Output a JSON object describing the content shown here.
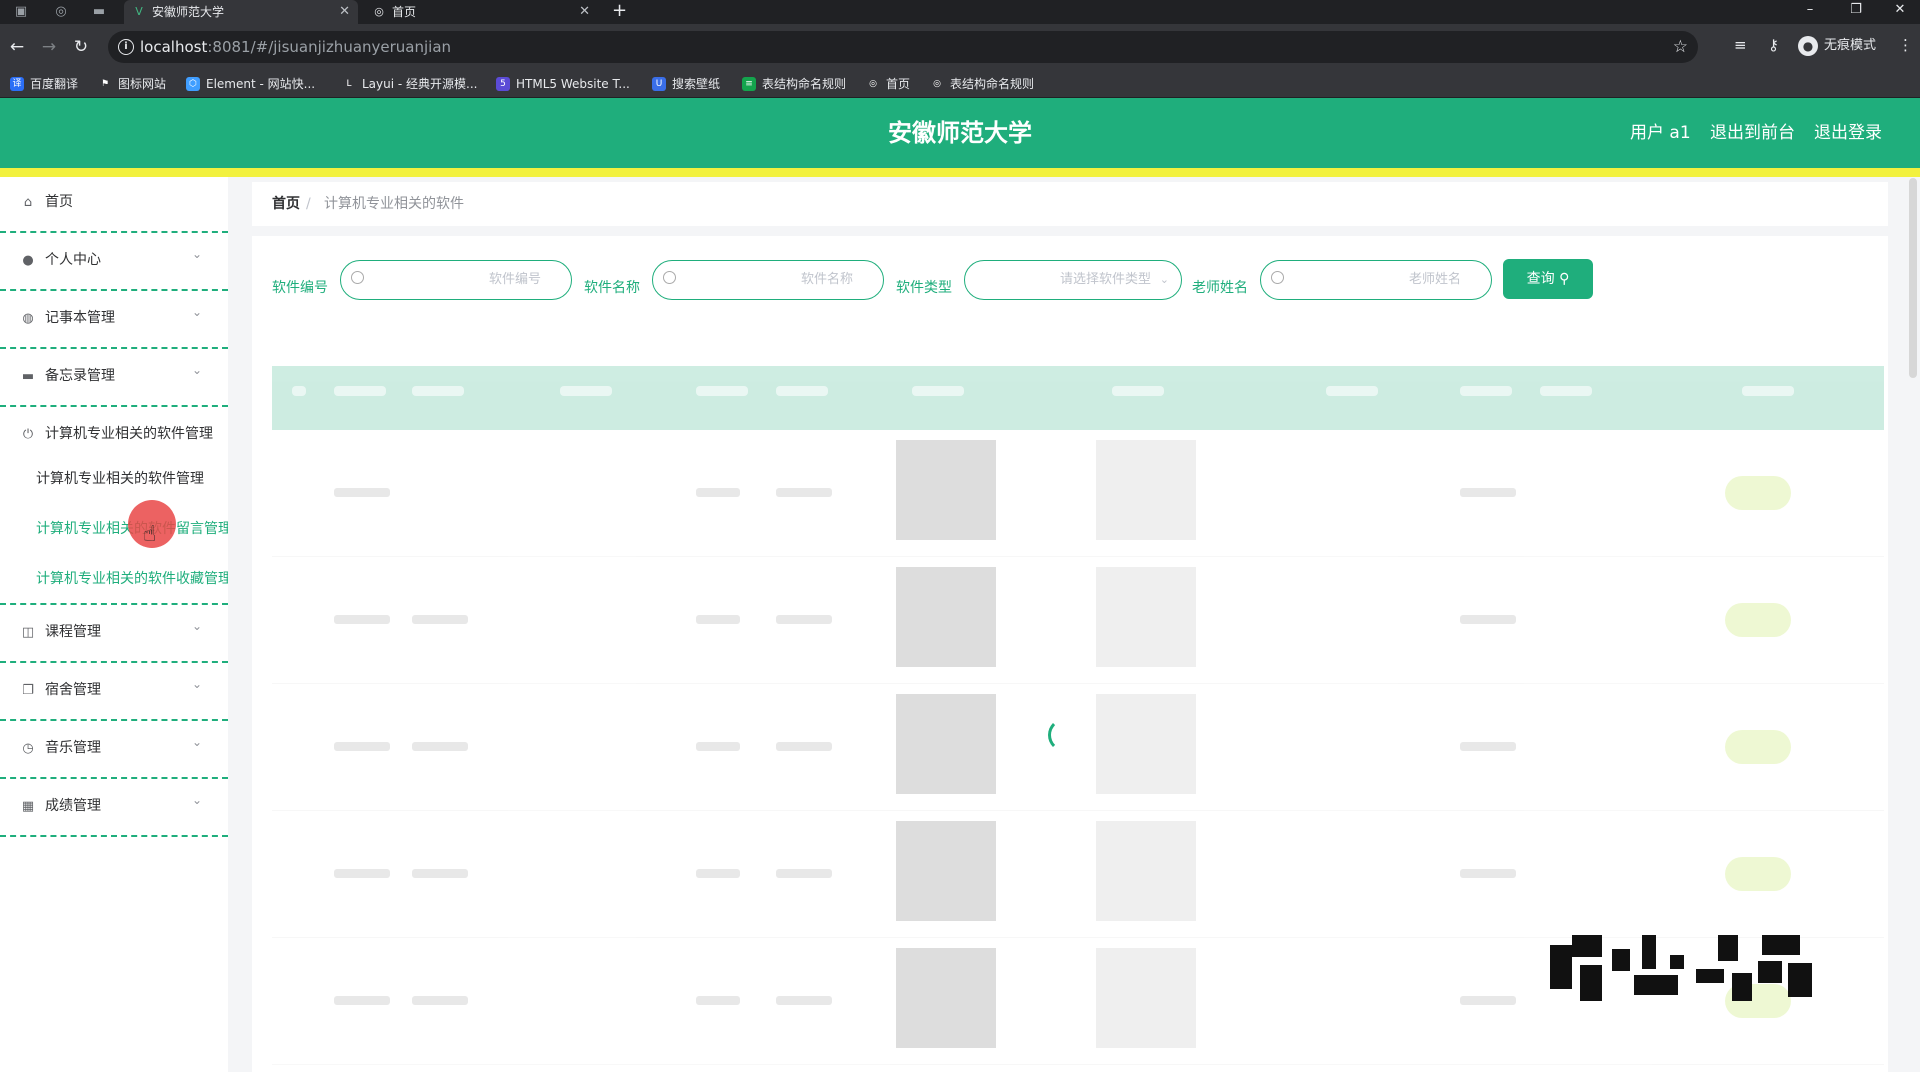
{
  "browser": {
    "tabs": [
      {
        "title": "安徽师范大学",
        "active": true
      },
      {
        "title": "首页",
        "active": false
      }
    ],
    "url_host": "localhost",
    "url_rest": ":8081/#/jisuanjizhuanyeruanjian",
    "profile_label": "无痕模式",
    "bookmarks": [
      "百度翻译",
      "图标网站",
      "Element - 网站快...",
      "Layui - 经典开源模...",
      "HTML5 Website T...",
      "搜索壁纸",
      "表结构命名规则",
      "首页",
      "表结构命名规则"
    ]
  },
  "header": {
    "title": "安徽师范大学",
    "user": "用户 a1",
    "back_front": "退出到前台",
    "logout": "退出登录",
    "color": "#1fae7c"
  },
  "sidebar": {
    "items": [
      {
        "label": "首页",
        "icon": "home-icon",
        "expandable": false
      },
      {
        "label": "个人中心",
        "icon": "user-icon",
        "expandable": true
      },
      {
        "label": "记事本管理",
        "icon": "notebook-icon",
        "expandable": true
      },
      {
        "label": "备忘录管理",
        "icon": "memo-icon",
        "expandable": true
      },
      {
        "label": "计算机专业相关的软件管理",
        "icon": "power-icon",
        "expandable": false
      },
      {
        "label": "课程管理",
        "icon": "course-icon",
        "expandable": true
      },
      {
        "label": "宿舍管理",
        "icon": "dorm-icon",
        "expandable": true
      },
      {
        "label": "音乐管理",
        "icon": "clock-icon",
        "expandable": true
      },
      {
        "label": "成绩管理",
        "icon": "grid-icon",
        "expandable": true
      }
    ],
    "subitems": [
      {
        "label": "计算机专业相关的软件管理"
      },
      {
        "label": "计算机专业相关的软件留言管理"
      },
      {
        "label": "计算机专业相关的软件收藏管理"
      }
    ]
  },
  "breadcrumb": {
    "home": "首页",
    "separator": "/",
    "current": "计算机专业相关的软件"
  },
  "filters": {
    "software_no": {
      "label": "软件编号",
      "placeholder": "软件编号"
    },
    "software_name": {
      "label": "软件名称",
      "placeholder": "软件名称"
    },
    "software_type": {
      "label": "软件类型",
      "placeholder": "请选择软件类型"
    },
    "teacher_name": {
      "label": "老师姓名",
      "placeholder": "老师姓名"
    },
    "query_button": "查询"
  },
  "table": {
    "loading": true,
    "rows": 5
  }
}
